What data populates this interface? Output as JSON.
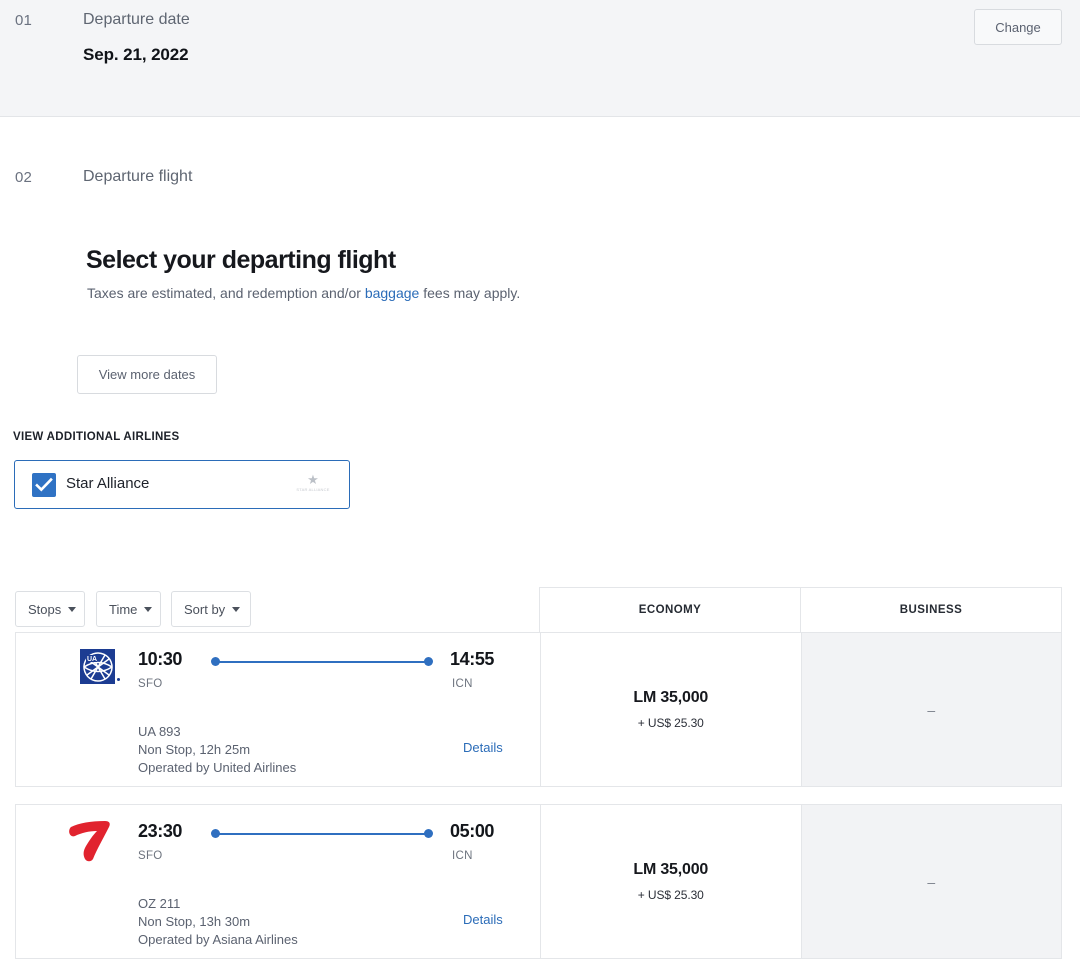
{
  "steps": {
    "date": {
      "number": "01",
      "label": "Departure date",
      "value": "Sep. 21, 2022",
      "change_label": "Change"
    },
    "flight": {
      "number": "02",
      "label": "Departure flight"
    }
  },
  "select_section": {
    "title": "Select your departing flight",
    "note_before": "Taxes are estimated, and redemption and/or ",
    "note_link": "baggage",
    "note_after": " fees may apply.",
    "view_more_dates_label": "View more dates"
  },
  "additional_airlines": {
    "label": "VIEW ADDITIONAL AIRLINES",
    "option_name": "Star Alliance",
    "option_checked": true,
    "logo_caption": "STAR ALLIANCE",
    "accent_color": "#2f72c4"
  },
  "filters": [
    {
      "label": "Stops",
      "icon": "chevron-down-icon"
    },
    {
      "label": "Time",
      "icon": "chevron-down-icon"
    },
    {
      "label": "Sort by",
      "icon": "chevron-down-icon"
    }
  ],
  "table": {
    "columns": [
      "ECONOMY",
      "BUSINESS"
    ],
    "empty_cell": "–",
    "details_label": "Details",
    "rows": [
      {
        "airline_logo": "united-airlines-logo",
        "depart_time": "10:30",
        "depart_code": "SFO",
        "arrive_time": "14:55",
        "arrive_code": "ICN",
        "flight_number": "UA 893",
        "stops_duration": "Non Stop, 12h 25m",
        "operated_by": "Operated by United Airlines",
        "fares": [
          {
            "cabin": "ECONOMY",
            "miles": "LM 35,000",
            "tax": "+ US$ 25.30",
            "available": true
          },
          {
            "cabin": "BUSINESS",
            "miles": "",
            "tax": "",
            "available": false
          }
        ]
      },
      {
        "airline_logo": "asiana-airlines-logo",
        "depart_time": "23:30",
        "depart_code": "SFO",
        "arrive_time": "05:00",
        "arrive_code": "ICN",
        "flight_number": "OZ 211",
        "stops_duration": "Non Stop, 13h 30m",
        "operated_by": "Operated by Asiana Airlines",
        "fares": [
          {
            "cabin": "ECONOMY",
            "miles": "LM 35,000",
            "tax": "+ US$ 25.30",
            "available": true
          },
          {
            "cabin": "BUSINESS",
            "miles": "",
            "tax": "",
            "available": false
          }
        ]
      }
    ]
  },
  "colors": {
    "link": "#2b6cb8",
    "route_line": "#2f6fc0",
    "united_blue": "#1c3c92",
    "asiana_red": "#e1232e",
    "section_bg": "#f4f5f7"
  }
}
